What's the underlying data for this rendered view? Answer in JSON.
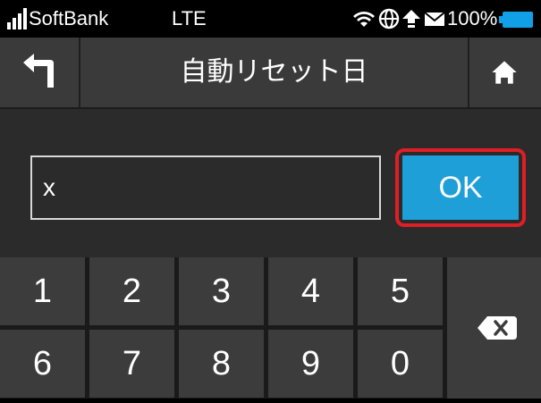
{
  "status_bar": {
    "carrier": "SoftBank",
    "network": "LTE",
    "battery": "100%",
    "icons": [
      "signal-icon",
      "wifi-icon",
      "globe-icon",
      "upload-icon",
      "mail-icon",
      "battery-icon"
    ]
  },
  "header": {
    "title": "自動リセット日",
    "back_icon": "back-arrow-icon",
    "home_icon": "home-icon"
  },
  "input": {
    "value": "x",
    "ok_label": "OK"
  },
  "keypad": {
    "keys": [
      "1",
      "2",
      "3",
      "4",
      "5",
      "6",
      "7",
      "8",
      "9",
      "0"
    ],
    "backspace_icon": "backspace-icon"
  },
  "colors": {
    "accent": "#1e9fd8",
    "highlight": "#e01e26",
    "battery": "#11a0e8"
  }
}
